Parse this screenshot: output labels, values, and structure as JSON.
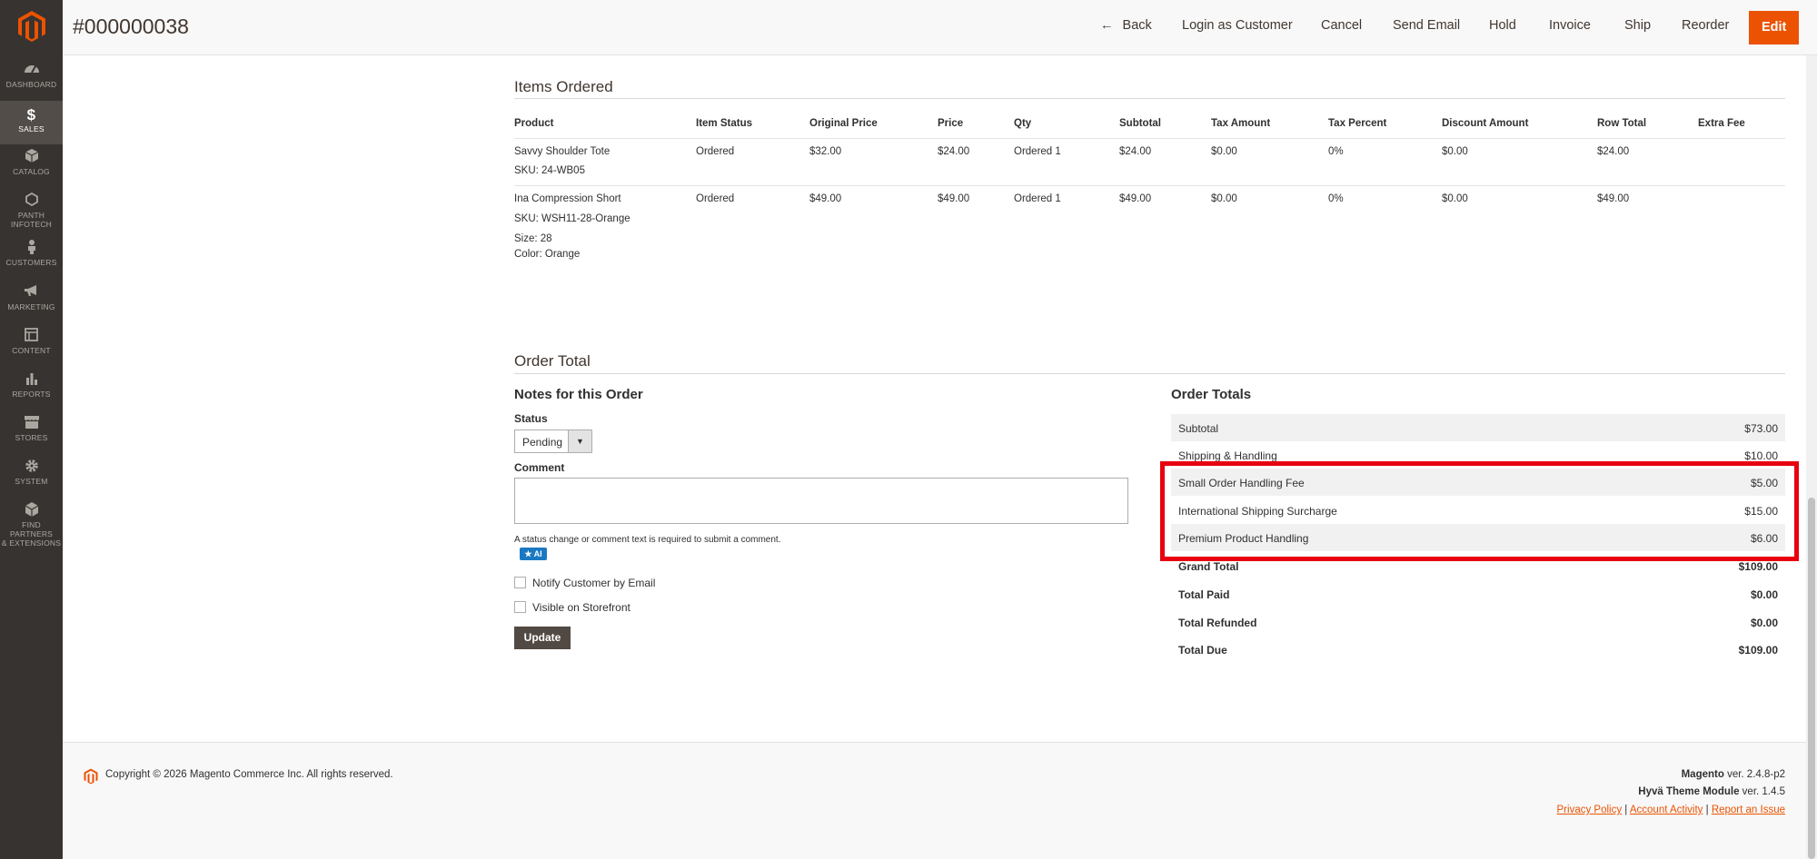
{
  "order": {
    "number": "#000000038"
  },
  "sidebar": {
    "items": [
      {
        "label": "DASHBOARD",
        "icon": "dashboard-icon"
      },
      {
        "label": "SALES",
        "icon": "dollar-icon",
        "active": true
      },
      {
        "label": "CATALOG",
        "icon": "catalog-icon"
      },
      {
        "label_line1": "PANTH",
        "label_line2": "INFOTECH",
        "icon": "hexagon-icon"
      },
      {
        "label": "CUSTOMERS",
        "icon": "customer-icon"
      },
      {
        "label": "MARKETING",
        "icon": "megaphone-icon"
      },
      {
        "label": "CONTENT",
        "icon": "content-icon"
      },
      {
        "label": "REPORTS",
        "icon": "reports-icon"
      },
      {
        "label": "STORES",
        "icon": "stores-icon"
      },
      {
        "label": "SYSTEM",
        "icon": "gear-icon"
      },
      {
        "label_line1": "FIND PARTNERS",
        "label_line2": "& EXTENSIONS",
        "icon": "extensions-icon"
      }
    ]
  },
  "header": {
    "back": "Back",
    "login_as_customer": "Login as Customer",
    "cancel": "Cancel",
    "send_email": "Send Email",
    "hold": "Hold",
    "invoice": "Invoice",
    "ship": "Ship",
    "reorder": "Reorder",
    "edit": "Edit"
  },
  "items": {
    "title": "Items Ordered",
    "columns": [
      "Product",
      "Item Status",
      "Original Price",
      "Price",
      "Qty",
      "Subtotal",
      "Tax Amount",
      "Tax Percent",
      "Discount Amount",
      "Row Total",
      "Extra Fee"
    ],
    "rows": [
      {
        "name": "Savvy Shoulder Tote",
        "sku": "SKU: 24-WB05",
        "status": "Ordered",
        "original_price": "$32.00",
        "price": "$24.00",
        "qty": "Ordered 1",
        "subtotal": "$24.00",
        "tax_amount": "$0.00",
        "tax_percent": "0%",
        "discount": "$0.00",
        "row_total": "$24.00"
      },
      {
        "name": "Ina Compression Short",
        "sku": "SKU: WSH11-28-Orange",
        "size_label": "Size:",
        "size": "28",
        "color_label": "Color:",
        "color": "Orange",
        "status": "Ordered",
        "original_price": "$49.00",
        "price": "$49.00",
        "qty": "Ordered 1",
        "subtotal": "$49.00",
        "tax_amount": "$0.00",
        "tax_percent": "0%",
        "discount": "$0.00",
        "row_total": "$49.00"
      }
    ]
  },
  "order_total": {
    "title": "Order Total",
    "notes": {
      "title": "Notes for this Order",
      "status_label": "Status",
      "status_value": "Pending",
      "comment_label": "Comment",
      "comment_value": "",
      "note": "A status change or comment text is required to submit a comment.",
      "ai_badge": "★ AI",
      "notify_label": "Notify Customer by Email",
      "visible_label": "Visible on Storefront",
      "update": "Update"
    },
    "totals": {
      "title": "Order Totals",
      "rows": [
        {
          "label": "Subtotal",
          "value": "$73.00"
        },
        {
          "label": "Shipping & Handling",
          "value": "$10.00"
        },
        {
          "label": "Small Order Handling Fee",
          "value": "$5.00"
        },
        {
          "label": "International Shipping Surcharge",
          "value": "$15.00"
        },
        {
          "label": "Premium Product Handling",
          "value": "$6.00"
        },
        {
          "label": "Grand Total",
          "value": "$109.00"
        },
        {
          "label": "Total Paid",
          "value": "$0.00"
        },
        {
          "label": "Total Refunded",
          "value": "$0.00"
        },
        {
          "label": "Total Due",
          "value": "$109.00"
        }
      ]
    }
  },
  "footer": {
    "copyright": "Copyright © 2026 Magento Commerce Inc. All rights reserved.",
    "magento_name": "Magento",
    "magento_ver": " ver. 2.4.8-p2",
    "hyva_name": "Hyvä Theme Module",
    "hyva_ver": " ver. 1.4.5",
    "privacy": "Privacy Policy",
    "account_activity": "Account Activity",
    "report_issue": "Report an Issue",
    "separator": "|"
  },
  "colors": {
    "accent": "#eb5202",
    "sidebar": "#373330",
    "highlight": "#e8000f",
    "ai_badge": "#1979c3"
  }
}
